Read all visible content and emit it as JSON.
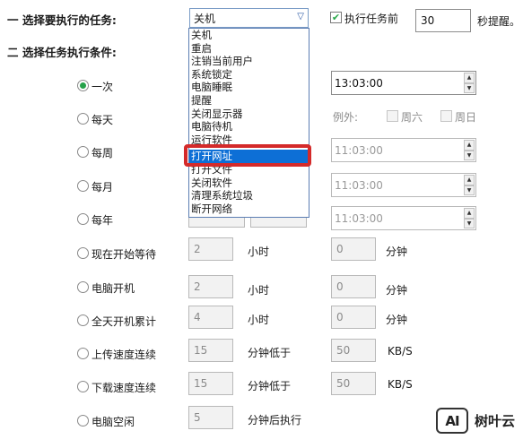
{
  "section1": {
    "title": "一 选择要执行的任务:"
  },
  "task_combo": {
    "selected": "关机",
    "arrow": "▽"
  },
  "task_options": [
    "关机",
    "重启",
    "注销当前用户",
    "系统锁定",
    "电脑睡眠",
    "提醒",
    "关闭显示器",
    "电脑待机",
    "运行软件",
    "打开网址",
    "打开文件",
    "关闭软件",
    "清理系统垃圾",
    "断开网络"
  ],
  "highlighted_option": "打开网址",
  "remind": {
    "label": "执行任务前",
    "checked": true,
    "value": "30",
    "unit": "秒提醒。"
  },
  "section2": {
    "title": "二 选择任务执行条件:"
  },
  "conditions": [
    {
      "label": "一次",
      "selected": true
    },
    {
      "label": "每天",
      "selected": false
    },
    {
      "label": "每周",
      "selected": false
    },
    {
      "label": "每月",
      "selected": false
    },
    {
      "label": "每年",
      "selected": false
    },
    {
      "label": "现在开始等待",
      "selected": false
    },
    {
      "label": "电脑开机",
      "selected": false
    },
    {
      "label": "全天开机累计",
      "selected": false
    },
    {
      "label": "上传速度连续",
      "selected": false
    },
    {
      "label": "下载速度连续",
      "selected": false
    },
    {
      "label": "电脑空闲",
      "selected": false
    }
  ],
  "times": {
    "once": "13:03:00",
    "week": "11:03:00",
    "month": "11:03:00",
    "year": "11:03:00"
  },
  "exceptions": {
    "label": "例外:",
    "sat": "周六",
    "sun": "周日"
  },
  "wait": {
    "hours": "2",
    "hours_unit": "小时",
    "minutes": "0",
    "minutes_unit": "分钟"
  },
  "boot": {
    "hours": "2",
    "hours_unit": "小时",
    "minutes": "0",
    "minutes_unit": "分钟"
  },
  "allday": {
    "hours": "4",
    "hours_unit": "小时",
    "minutes": "0",
    "minutes_unit": "分钟"
  },
  "upload": {
    "minutes": "15",
    "mid_label": "分钟低于",
    "speed": "50",
    "unit": "KB/S"
  },
  "download": {
    "minutes": "15",
    "mid_label": "分钟低于",
    "speed": "50",
    "unit": "KB/S"
  },
  "idle": {
    "minutes": "5",
    "unit": "分钟后执行"
  },
  "watermark": {
    "logo": "AI",
    "text": "树叶云"
  },
  "colors": {
    "accent": "#0d6fd6",
    "highlight_border": "#d42a2a",
    "radio_green": "#26a14a"
  }
}
